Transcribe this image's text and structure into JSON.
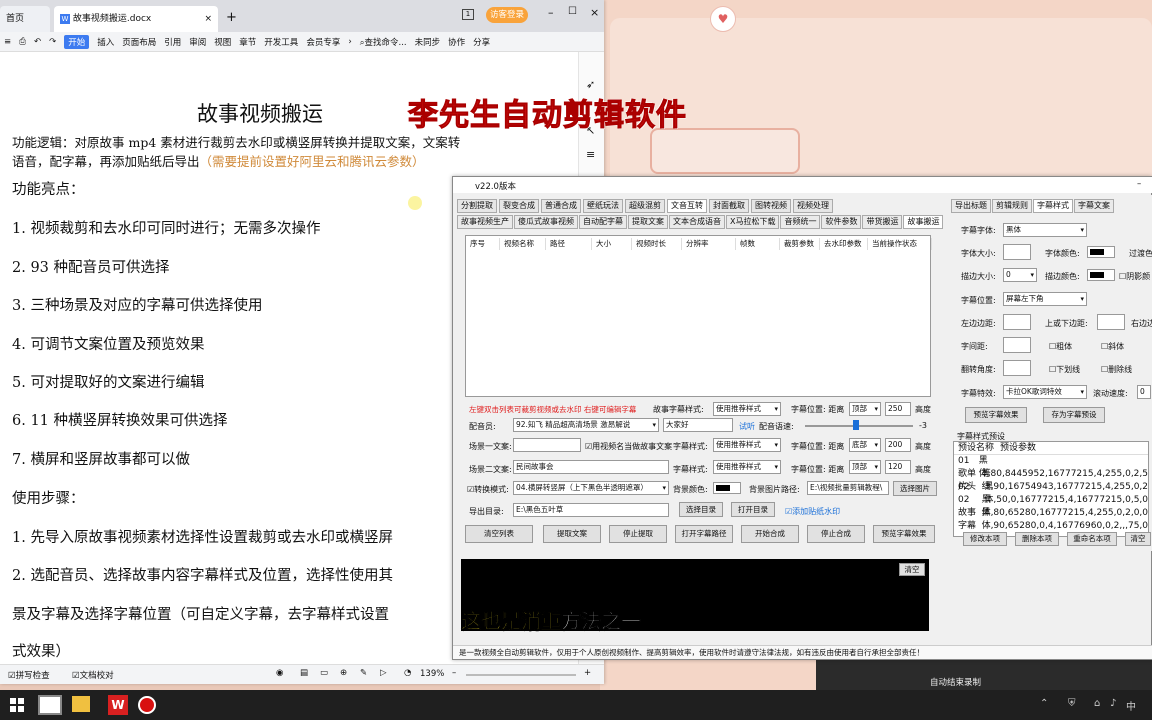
{
  "wps": {
    "tab_home": "首页",
    "tab_doc": "故事视频搬运.docx",
    "login": "访客登录",
    "ribbon": [
      "开始",
      "插入",
      "页面布局",
      "引用",
      "审阅",
      "视图",
      "章节",
      "开发工具",
      "会员专享"
    ],
    "search": "查找命令...",
    "sync": "未同步",
    "collab": "协作",
    "share": "分享",
    "status_spell": "拼写检查",
    "status_proof": "文档校对",
    "zoom": "139%"
  },
  "doc": {
    "title": "故事视频搬运",
    "logic1": "功能逻辑：对原故事 mp4 素材进行裁剪去水印或横竖屏转换并提取文案，文案转",
    "logic2": "语音，配字幕，再添加贴纸后导出",
    "logic_note": "（需要提前设置好阿里云和腾讯云参数）",
    "h1": "功能亮点：",
    "items": [
      "1. 视频裁剪和去水印可同时进行；无需多次操作",
      "2. 93 种配音员可供选择",
      "3. 三种场景及对应的字幕可供选择使用",
      "4. 可调节文案位置及预览效果",
      "5. 可对提取好的文案进行编辑",
      "6. 11 种横竖屏转换效果可供选择",
      "7. 横屏和竖屏故事都可以做"
    ],
    "h2": "使用步骤：",
    "steps": [
      "1. 先导入原故事视频素材选择性设置裁剪或去水印或横竖屏",
      "2. 选配音员、选择故事内容字幕样式及位置，选择性使用其",
      "景及字幕及选择字幕位置（可自定义字幕，去字幕样式设置",
      "式效果）"
    ]
  },
  "banner": "李先生自动剪辑软件",
  "app": {
    "title": "v22.0版本",
    "toolbar": [
      "分割提取",
      "裂变合成",
      "普通合成",
      "壁纸玩法",
      "超级混剪",
      "文音互转",
      "封面截取",
      "图转视频",
      "视频处理"
    ],
    "right_tabs": [
      "导出标题",
      "剪辑规则",
      "字幕样式",
      "字幕文案"
    ],
    "tabs": [
      "故事视频生产",
      "傻瓜式故事视频",
      "自动配字幕",
      "提取文案",
      "文本合成语音",
      "X马拉松下载",
      "音频统一",
      "软件参数",
      "带货搬运",
      "故事搬运"
    ],
    "columns": [
      "序号",
      "视频名称",
      "路径",
      "大小",
      "视频时长",
      "分辨率",
      "帧数",
      "裁剪参数",
      "去水印参数",
      "当前操作状态"
    ],
    "hint": "左键双击列表可裁剪视频或去水印 右键可编辑字幕",
    "style_label": "故事字幕样式:",
    "style_value": "使用推荐样式",
    "pos_label": "字幕位置: 距离",
    "pos_top": "顶部",
    "pos1": "250",
    "height_label": "高度",
    "voice_label": "配音员:",
    "voice_value": "92.知飞 精品超高清场景 激昂解说",
    "voice_text": "大家好",
    "try": "试听",
    "speed_label": "配音语速:",
    "speed_value": "-3",
    "scene1_label": "场景一文案:",
    "use_title": "用视频名当做故事文案",
    "sub_style": "字幕样式:",
    "pos_bottom": "底部",
    "pos2": "200",
    "scene2_label": "场景二文案:",
    "scene2_value": "民间故事会",
    "pos3": "120",
    "convert_label": "转换模式:",
    "convert_value": "04.横屏转竖屏（上下黑色半透明遮罩）",
    "bg_color": "背景颜色:",
    "bg_image": "背景图片路径:",
    "bg_path": "E:\\视频批量剪辑教程\\",
    "pick_image": "选择图片",
    "out_label": "导出目录:",
    "out_value": "E:\\黑色五叶草",
    "pick_dir": "选择目录",
    "open_dir": "打开目录",
    "add_sticker": "添加贴纸水印",
    "buttons": [
      "清空列表",
      "提取文案",
      "停止提取",
      "打开字幕路径",
      "开始合成",
      "停止合成",
      "预览字幕效果"
    ],
    "clear": "清空",
    "subtitle_yellow": "这也是消重",
    "subtitle_white": "方法之一",
    "footer": "是一款视频全自动剪辑软件，仅用于个人原创视频制作、提高剪辑效率，使用软件时请遵守法律法规，如有违反由使用者自行承担全部责任！"
  },
  "rpanel": {
    "font_label": "字幕字体:",
    "font_value": "黑体",
    "size_label": "字体大小:",
    "color_label": "字体颜色:",
    "overlay": "过渡色",
    "stroke_label": "描边大小:",
    "stroke_value": "0",
    "stroke_color": "描边颜色:",
    "shadow": "阴影颜",
    "pos_label": "字幕位置:",
    "pos_value": "屏幕左下角",
    "left_margin": "左边边距:",
    "tb_margin": "上或下边距:",
    "right_margin": "右边边",
    "spacing": "字间距:",
    "bold": "粗体",
    "italic": "斜体",
    "angle": "翻转角度:",
    "underline": "下划线",
    "strike": "删除线",
    "effect_label": "字幕特效:",
    "effect_value": "卡拉OK歌词特效",
    "scroll": "滚动速度:",
    "scroll_value": "0",
    "preview_btn": "预览字幕效果",
    "save_btn": "存为字幕预设",
    "preset_title": "字幕样式预设",
    "preset_cols": [
      "预设名称",
      "预设参数"
    ],
    "presets": [
      [
        "01",
        "黑体,80,8445952,16777215,4,255,0,2,5"
      ],
      [
        "歌单02",
        "等线,90,16754943,16777215,4,255,0,2"
      ],
      [
        "片头",
        "黑体,50,0,16777215,4,16777215,0,5,0"
      ],
      [
        "02",
        "黑体,80,65280,16777215,4,255,0,2,0,0"
      ],
      [
        "故事字幕",
        "黑体,90,65280,0,4,16776960,0,2,,,75,0"
      ]
    ],
    "edit": "修改本项",
    "delete": "删除本项",
    "rename": "重命名本项",
    "clear": "清空"
  },
  "task": {
    "caption": "自动结束录制",
    "ime": "中"
  }
}
